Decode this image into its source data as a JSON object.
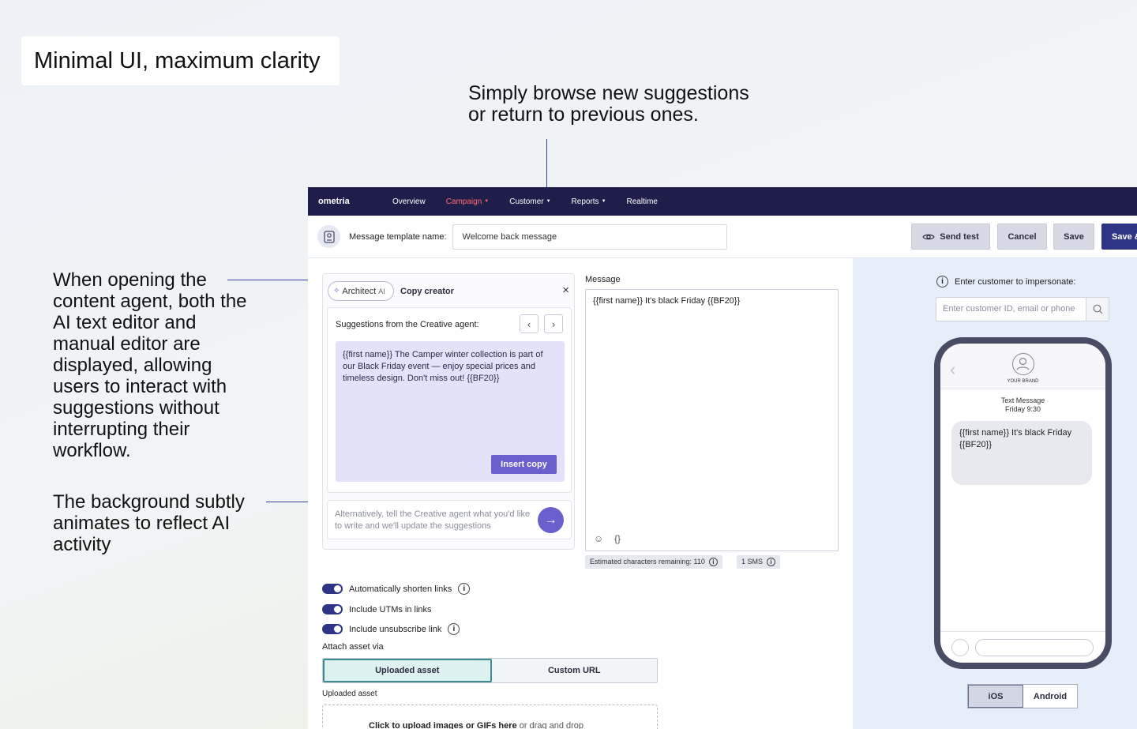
{
  "headline": "Minimal UI, maximum clarity",
  "annotations": {
    "top": "Simply browse new suggestions\nor return to previous ones.",
    "left_1": "When opening the content agent, both the AI text editor and manual editor are displayed, allowing users to interact with suggestions without interrupting their workflow.",
    "left_2": "The background subtly animates to reflect AI activity"
  },
  "app": {
    "logo": "ometria",
    "nav": [
      {
        "label": "Overview",
        "active": false,
        "caret": false
      },
      {
        "label": "Campaign",
        "active": true,
        "caret": true
      },
      {
        "label": "Customer",
        "active": false,
        "caret": true
      },
      {
        "label": "Reports",
        "active": false,
        "caret": true
      },
      {
        "label": "Realtime",
        "active": false,
        "caret": false
      }
    ],
    "toolbar": {
      "template_label": "Message template name:",
      "template_value": "Welcome back message",
      "send_test": "Send test",
      "cancel": "Cancel",
      "save": "Save",
      "save_and": "Save &"
    },
    "agent_panel": {
      "architect_label": "Architect",
      "architect_ai": "AI",
      "copy_creator": "Copy creator",
      "close": "×",
      "suggestions_title": "Suggestions from the Creative agent:",
      "suggestion_text": "{{first name}} The Camper winter collection is part of our Black Friday event — enjoy special prices and timeless design. Don't miss out!  {{BF20}}",
      "insert_copy": "Insert copy",
      "alt_prompt": "Alternatively, tell the Creative agent what you'd like to write and we'll update the suggestions"
    },
    "message": {
      "label": "Message",
      "text": "{{first name}} It's black Friday {{BF20}}",
      "emoji_icon": "smile-icon",
      "braces": "{}",
      "chars_remaining": "Estimated characters remaining: 110",
      "sms_count": "1 SMS"
    },
    "options": {
      "shorten_links": "Automatically shorten links",
      "include_utms": "Include UTMs in links",
      "include_unsubscribe": "Include unsubscribe link",
      "attach_label": "Attach asset via",
      "attach_options": [
        "Uploaded asset",
        "Custom URL"
      ],
      "uploaded_label": "Uploaded asset",
      "upload_cta": "Click to upload images or GIFs here",
      "upload_suffix": " or drag and drop"
    },
    "preview": {
      "impersonate_label": "Enter customer to impersonate:",
      "impersonate_placeholder": "Enter customer ID, email or phone",
      "brand": "YOUR BRAND",
      "sms_type": "Text Message",
      "sms_time": "Friday 9:30",
      "bubble_text": "{{first name}} It's black Friday {{BF20}}",
      "os_options": [
        "iOS",
        "Android"
      ]
    }
  },
  "colors": {
    "nav_bg": "#1f1e4a",
    "nav_active": "#ff6b6b",
    "primary": "#2e3486",
    "ai_accent": "#6a5fcc",
    "suggestion_bg": "#e4e2fb",
    "preview_bg": "#e6eefa"
  }
}
